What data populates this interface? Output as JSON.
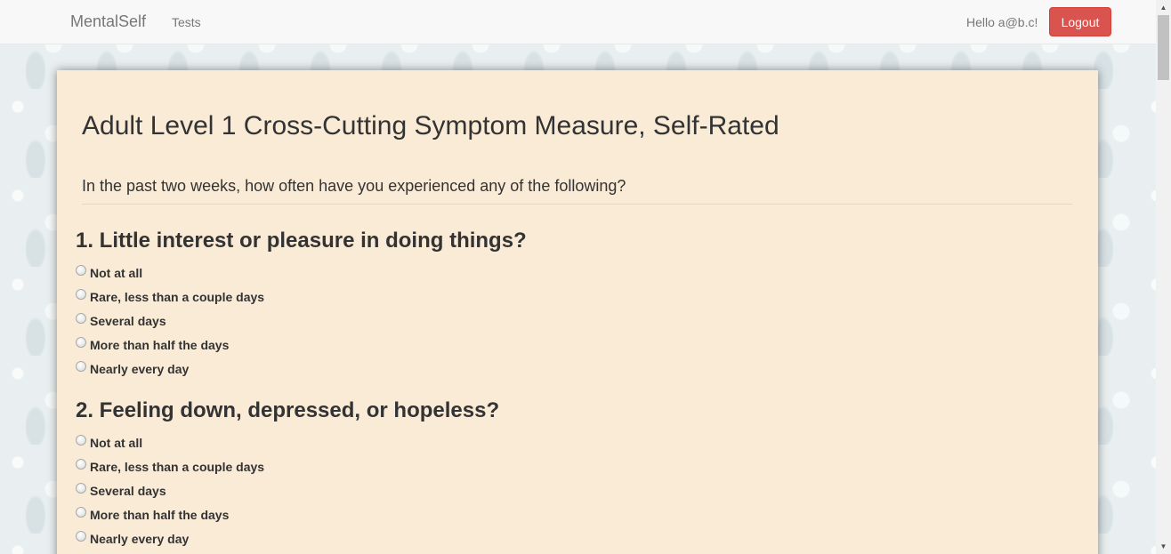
{
  "nav": {
    "brand": "MentalSelf",
    "tests_link": "Tests",
    "greeting": "Hello a@b.c!",
    "logout_label": "Logout"
  },
  "page": {
    "title": "Adult Level 1 Cross-Cutting Symptom Measure, Self-Rated",
    "instructions": "In the past two weeks, how often have you experienced any of the following?"
  },
  "questions": [
    {
      "text": "1. Little interest or pleasure in doing things?",
      "options": [
        "Not at all",
        "Rare, less than a couple days",
        "Several days",
        "More than half the days",
        "Nearly every day"
      ]
    },
    {
      "text": "2. Feeling down, depressed, or hopeless?",
      "options": [
        "Not at all",
        "Rare, less than a couple days",
        "Several days",
        "More than half the days",
        "Nearly every day"
      ]
    }
  ],
  "colors": {
    "card_background": "#faebd7",
    "logout_button": "#d9534f",
    "navbar": "#f8f8f8"
  }
}
